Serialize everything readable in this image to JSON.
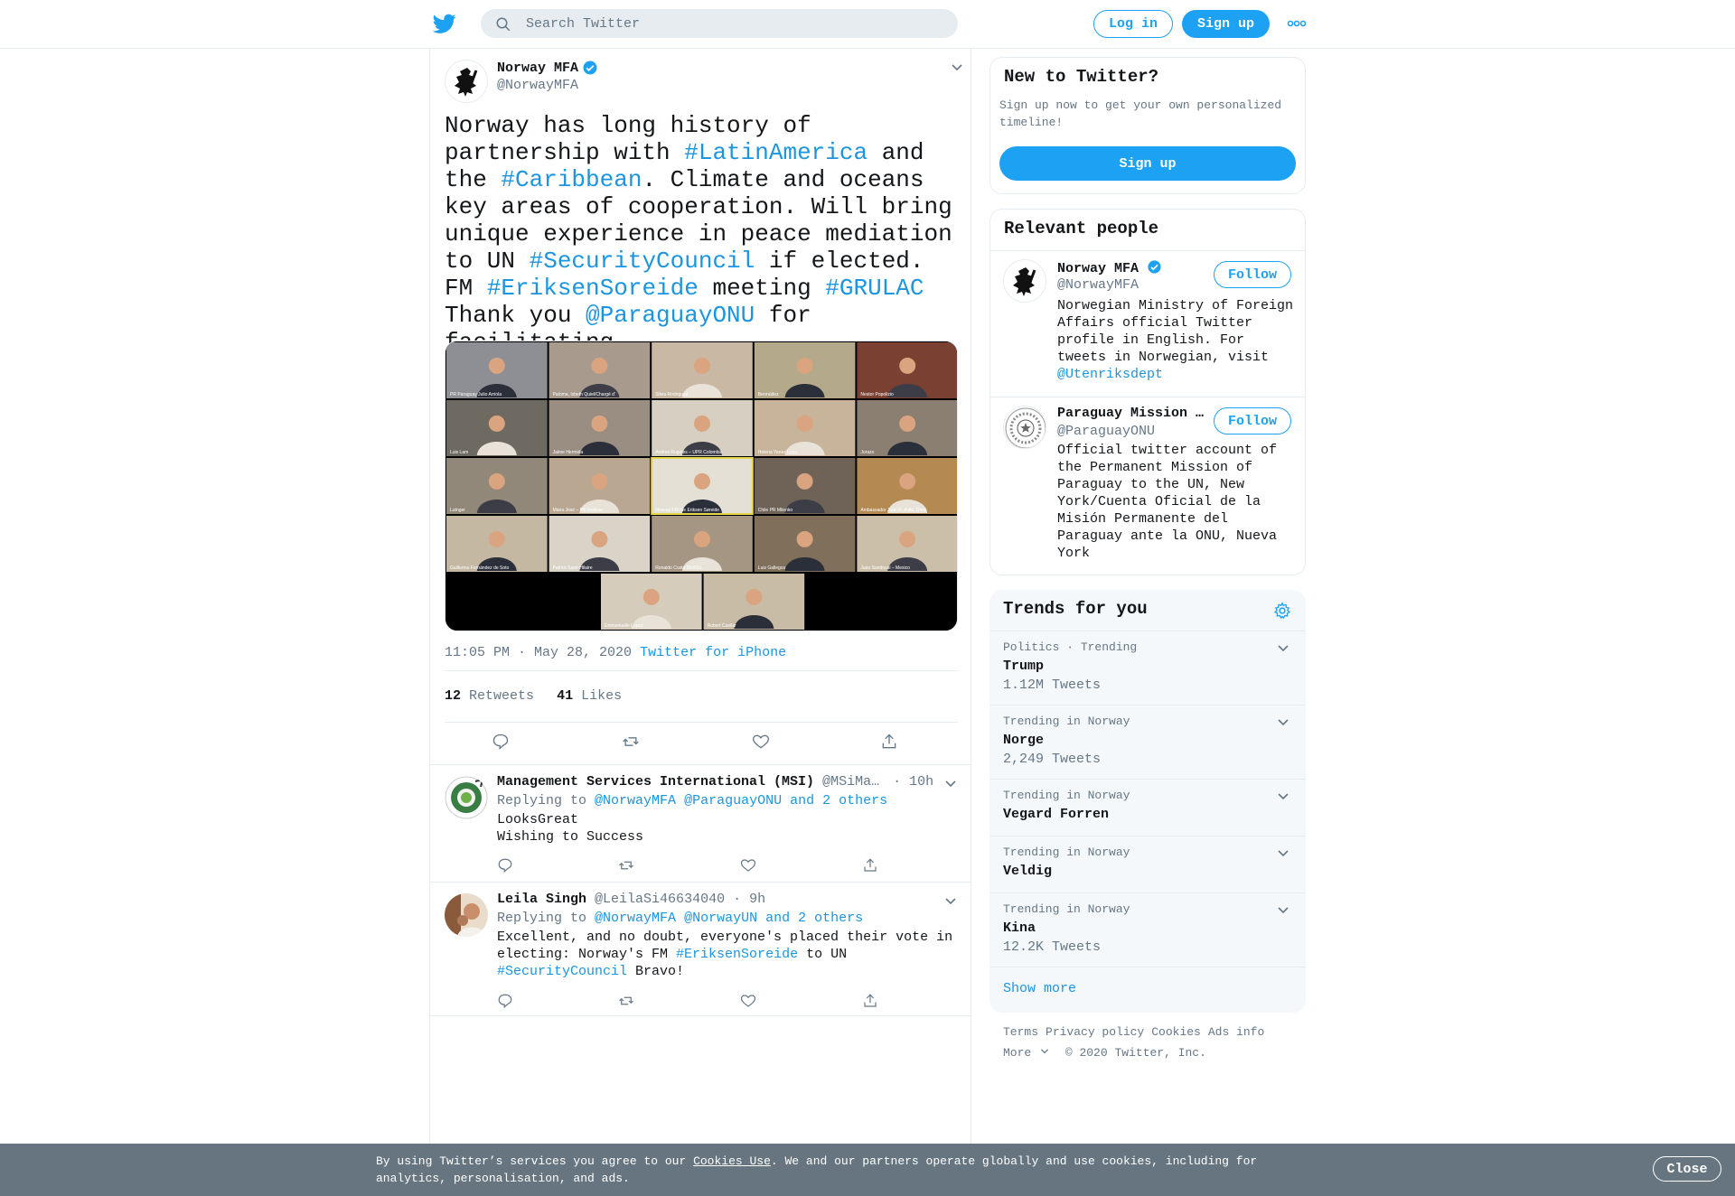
{
  "header": {
    "search_placeholder": "Search Twitter",
    "login_label": "Log in",
    "signup_label": "Sign up"
  },
  "tweet": {
    "author_name": "Norway MFA",
    "author_handle": "@NorwayMFA",
    "text_parts": [
      {
        "t": "Norway has long history of partnership with ",
        "link": false
      },
      {
        "t": "#LatinAmerica",
        "link": true
      },
      {
        "t": " and the ",
        "link": false
      },
      {
        "t": "#Caribbean",
        "link": true
      },
      {
        "t": ". Climate and oceans key areas of cooperation. Will bring unique experience in peace mediation to UN ",
        "link": false
      },
      {
        "t": "#SecurityCouncil",
        "link": true
      },
      {
        "t": " if elected. FM ",
        "link": false
      },
      {
        "t": "#EriksenSoreide",
        "link": true
      },
      {
        "t": " meeting ",
        "link": false
      },
      {
        "t": "#GRULAC",
        "link": true
      },
      {
        "t": " Thank you ",
        "link": false
      },
      {
        "t": "@ParaguayONU",
        "link": true
      },
      {
        "t": " for facilitating",
        "link": false
      }
    ],
    "time": "11:05 PM · May 28, 2020",
    "source": "Twitter for iPhone",
    "retweets_count": "12",
    "retweets_label": "Retweets",
    "likes_count": "41",
    "likes_label": "Likes",
    "media_tiles": [
      "PR Paraguay Julio Arriola",
      "Paloma, Izbeth Quiel/Chargé d'",
      "Silvia Rodriguez",
      "Bermúdez",
      "Nestor Popolizio",
      "Luis Lam",
      "Jaime Hermida",
      "Andres Rugeles – UPR Colombia",
      "Helena Yanez Loza",
      "Jorazo",
      "Lutnger",
      "Maria José – PR Noblow",
      "Norway FM Ine Eriksen Søreide",
      "Chile PR Milenko",
      "Ambassador Juan R. Avila, Domi",
      "Guillermo Fernández de Soto",
      "Patrick Saint-Hilaire",
      "Ronaldo Costa BRASIL",
      "Luis Gallegos",
      "Juan Sandoval – Mexico",
      "Emmanuelle Lopez",
      "Robert Cuellar"
    ]
  },
  "replies": [
    {
      "name": "Management Services International (MSI)",
      "handle": "@MSiMa…",
      "time": "· 10h",
      "replying_label": "Replying to",
      "replying_to": "@NorwayMFA @ParaguayONU and 2 others",
      "lines": [
        "LooksGreat",
        "Wishing to Success"
      ]
    },
    {
      "name": "Leila Singh",
      "handle": "@LeilaSi46634040",
      "time": "· 9h",
      "replying_label": "Replying to",
      "replying_to": "@NorwayMFA @NorwayUN and 2 others",
      "text_parts": [
        {
          "t": "Excellent, and no doubt, everyone's placed their vote in electing: Norway's FM ",
          "link": false
        },
        {
          "t": "#EriksenSoreide",
          "link": true
        },
        {
          "t": " to UN ",
          "link": false
        },
        {
          "t": "#SecurityCouncil",
          "link": true
        },
        {
          "t": " Bravo!",
          "link": false
        }
      ]
    }
  ],
  "sidebar": {
    "new_title": "New to Twitter?",
    "new_sub": "Sign up now to get your own personalized timeline!",
    "signup_label": "Sign up",
    "relevant_title": "Relevant people",
    "people": [
      {
        "name": "Norway MFA",
        "handle": "@NorwayMFA",
        "follow_label": "Follow",
        "bio": "Norwegian Ministry of Foreign Affairs official Twitter profile in English. For tweets in Norwegian, visit ",
        "bio_link": "@Utenriksdept"
      },
      {
        "name": "Paraguay Mission …",
        "handle": "@ParaguayONU",
        "follow_label": "Follow",
        "bio": "Official twitter account of the Permanent Mission of Paraguay to the UN, New York/Cuenta Oficial de la Misión Permanente del Paraguay ante la ONU, Nueva York",
        "bio_link": ""
      }
    ],
    "trends_title": "Trends for you",
    "trends": [
      {
        "context": "Politics · Trending",
        "name": "Trump",
        "count": "1.12M Tweets"
      },
      {
        "context": "Trending in Norway",
        "name": "Norge",
        "count": "2,249 Tweets"
      },
      {
        "context": "Trending in Norway",
        "name": "Vegard Forren",
        "count": ""
      },
      {
        "context": "Trending in Norway",
        "name": "Veldig",
        "count": ""
      },
      {
        "context": "Trending in Norway",
        "name": "Kina",
        "count": "12.2K Tweets"
      }
    ],
    "show_more": "Show more",
    "footer": {
      "links": [
        "Terms",
        "Privacy policy",
        "Cookies",
        "Ads info"
      ],
      "more": "More",
      "copyright": "© 2020 Twitter, Inc."
    }
  },
  "cookie": {
    "text_before": "By using Twitter’s services you agree to our ",
    "link": "Cookies Use",
    "text_after": ". We and our partners operate globally and use cookies, including for analytics, personalisation, and ads.",
    "close_label": "Close"
  },
  "colors": {
    "accent": "#1da1f2",
    "link": "#1b95e0",
    "muted": "#657786",
    "border": "#e6ecf0",
    "cookie_bg": "#66757f"
  }
}
